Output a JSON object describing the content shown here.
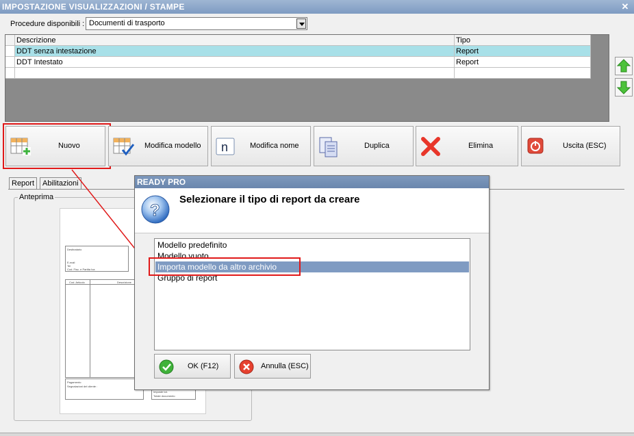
{
  "window": {
    "title": "IMPOSTAZIONE VISUALIZZAZIONI / STAMPE",
    "close_glyph": "✕"
  },
  "procedure": {
    "label": "Procedure disponibili :",
    "value": "Documenti di trasporto"
  },
  "grid": {
    "headers": [
      "Descrizione",
      "Tipo"
    ],
    "rows": [
      [
        "DDT senza intestazione",
        "Report"
      ],
      [
        "DDT Intestato",
        "Report"
      ]
    ]
  },
  "side_arrows": {
    "up_icon": "arrow-up-icon",
    "down_icon": "arrow-down-icon"
  },
  "toolbar": {
    "nuovo": "Nuovo",
    "modifica_modello": "Modifica modello",
    "modifica_nome": "Modifica nome",
    "duplica": "Duplica",
    "elimina": "Elimina",
    "uscita": "Uscita (ESC)"
  },
  "tabs": [
    "Report",
    "Abilitazioni"
  ],
  "preview": {
    "label": "Anteprima",
    "paper": {
      "addressee": "Destinatario",
      "contact_lines": [
        "E-mail",
        "Tel",
        "Cod. Fisc. e Partita Iva"
      ],
      "col_code": "Cod. Articolo",
      "col_desc": "Descrizione",
      "payment": "Pagamento",
      "notes": "Segnalazioni del cliente :",
      "tax": "Imposte tot.",
      "total": "Totale documento"
    }
  },
  "dialog": {
    "title": "READY PRO",
    "question": "Selezionare il tipo di report da creare",
    "options": [
      "Modello predefinito",
      "Modello vuoto",
      "Importa modello da altro archivio",
      "Gruppo di report"
    ],
    "selected_option": "Importa modello da altro archivio",
    "ok_label": "OK (F12)",
    "cancel_label": "Annulla (ESC)"
  },
  "colors": {
    "highlight_red": "#e01818",
    "selection_row": "#a8e0e8",
    "list_selection": "#7f9bc2",
    "title_bar": "#8aa5c8"
  }
}
